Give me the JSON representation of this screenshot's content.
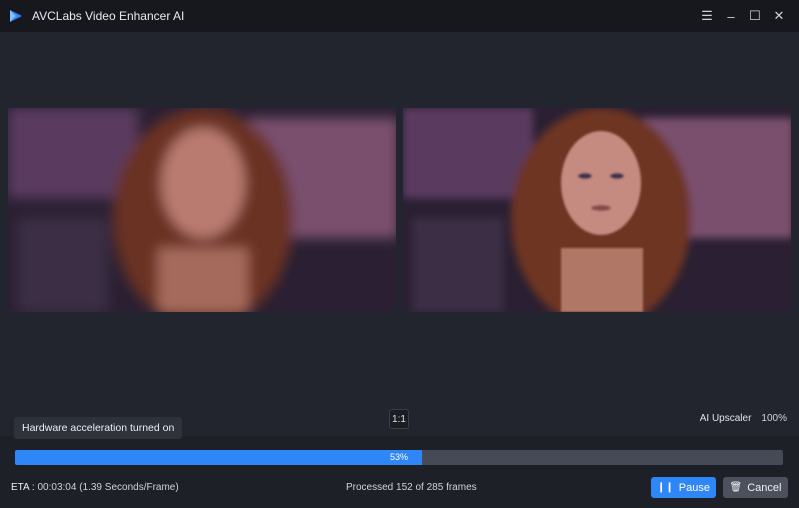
{
  "app": {
    "title": "AVCLabs Video Enhancer AI"
  },
  "window_controls": {
    "menu_icon": "menu-icon",
    "minimize_icon": "minimize-icon",
    "maximize_icon": "maximize-icon",
    "close_icon": "close-icon"
  },
  "preview": {
    "left_label": "",
    "right_label": "",
    "ratio_button": "1:1",
    "model_name": "AI Upscaler",
    "model_percent": "100%"
  },
  "tooltip": {
    "text": "Hardware acceleration turned on"
  },
  "progress": {
    "value": 0.53,
    "label": "53%"
  },
  "status": {
    "eta_label": "ETA :",
    "eta_value": "00:03:04 (1.39 Seconds/Frame)",
    "processed_text": "Processed 152 of 285 frames"
  },
  "actions": {
    "pause_label": "Pause",
    "cancel_label": "Cancel"
  },
  "colors": {
    "accent": "#2f86f6",
    "background": "#22252e",
    "titlebar": "#16181d"
  }
}
